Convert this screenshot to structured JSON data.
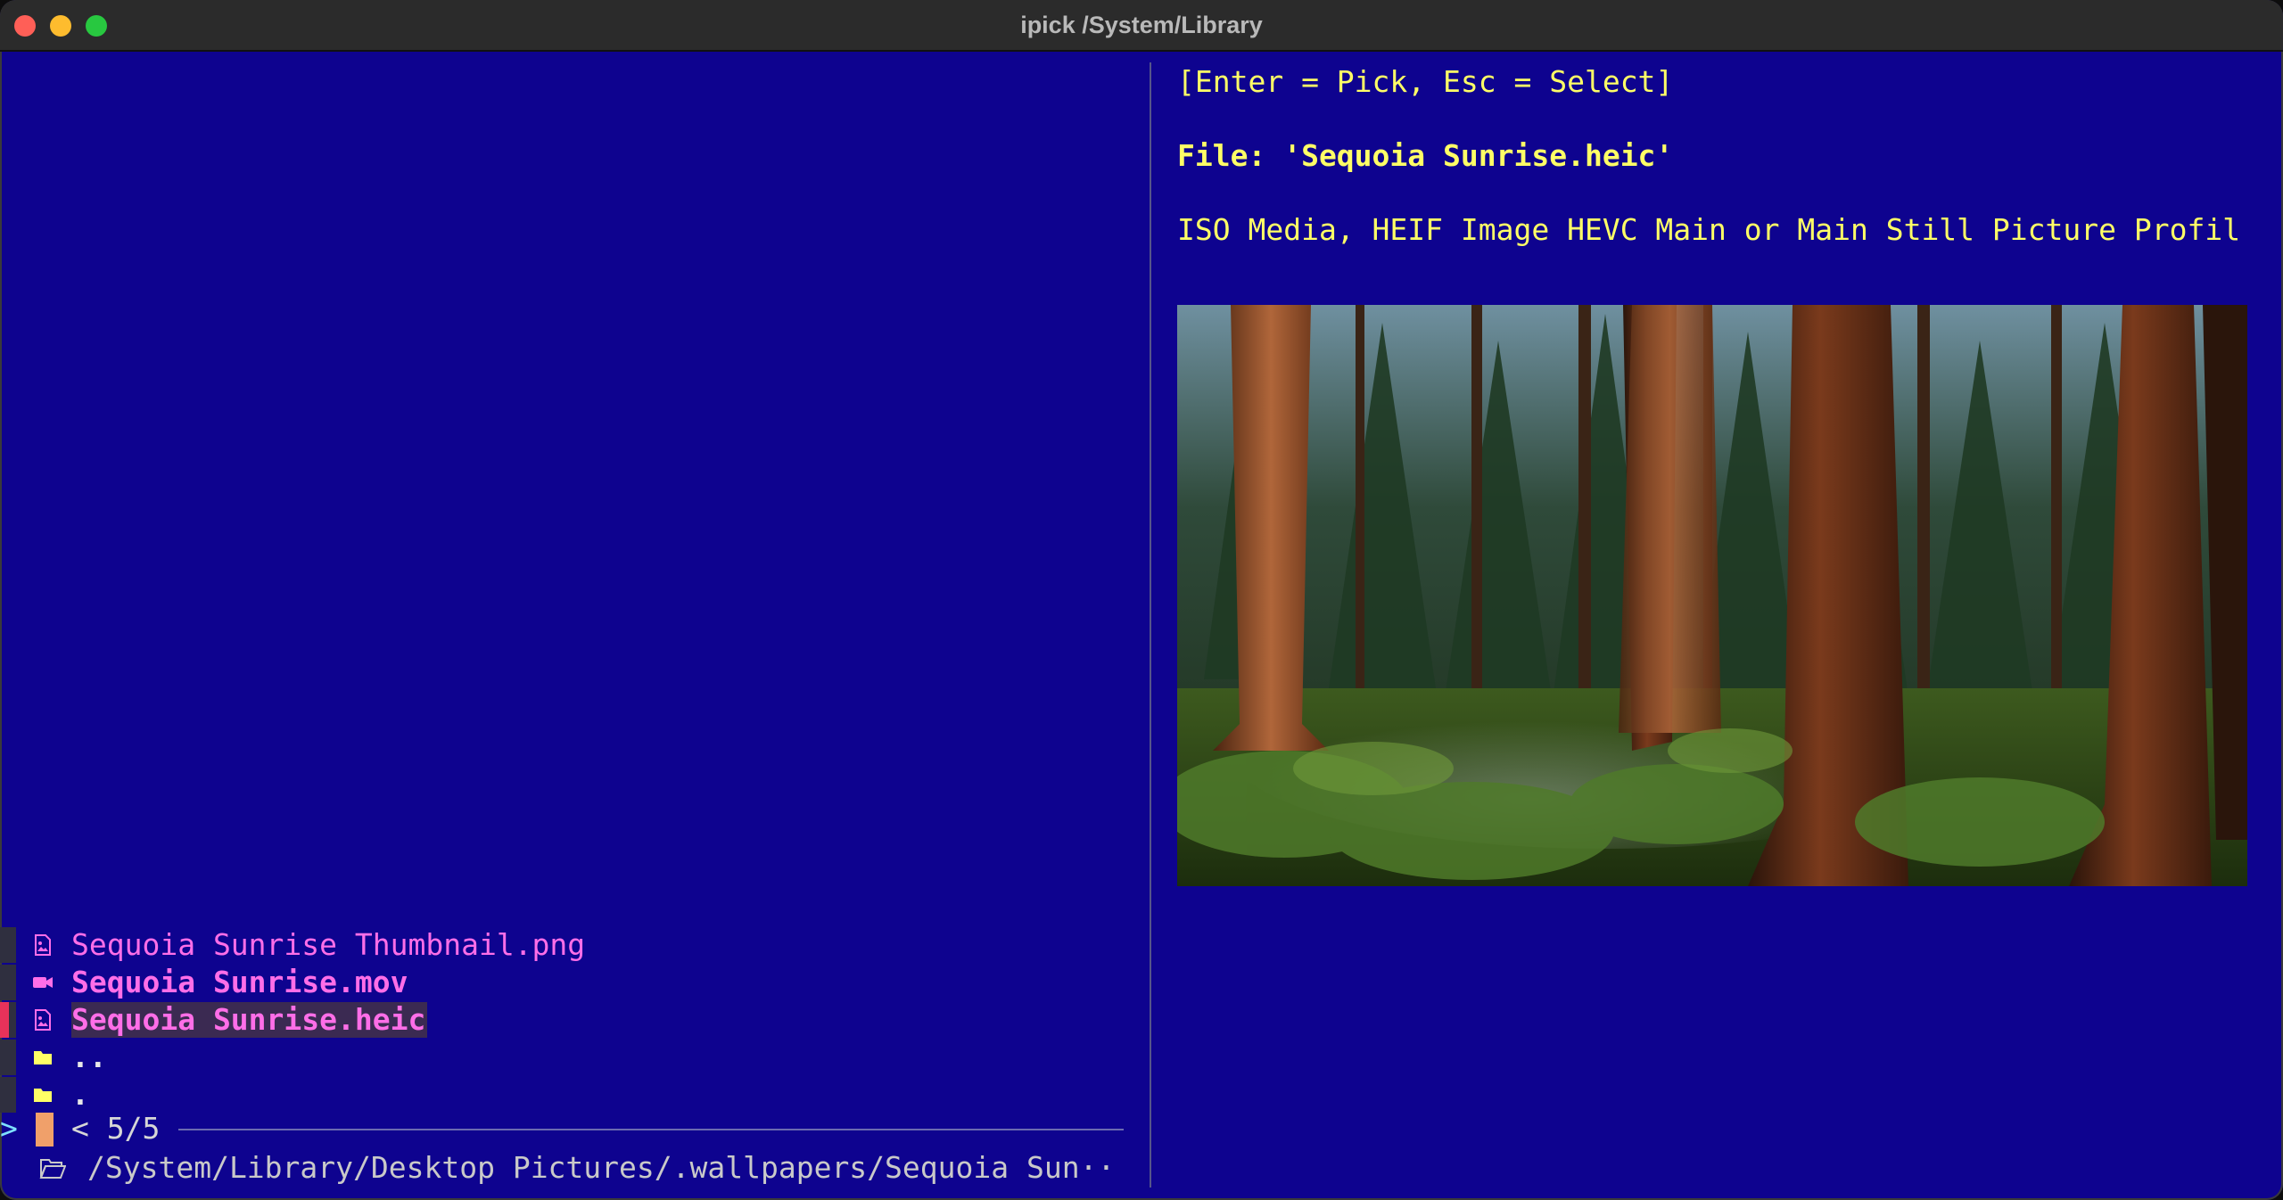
{
  "window": {
    "title": "ipick /System/Library"
  },
  "list": {
    "items": [
      {
        "name": "Sequoia Sunrise Thumbnail.png",
        "icon": "image-file-icon"
      },
      {
        "name": "Sequoia Sunrise.mov",
        "icon": "video-file-icon"
      },
      {
        "name": "Sequoia Sunrise.heic",
        "icon": "image-file-icon",
        "selected": true
      },
      {
        "name": "..",
        "icon": "folder-icon"
      },
      {
        "name": ".",
        "icon": "folder-icon"
      }
    ]
  },
  "prompt": {
    "caret": ">",
    "counter": "< 5/5"
  },
  "path": {
    "text": "/System/Library/Desktop Pictures/.wallpapers/Sequoia Sun··"
  },
  "preview": {
    "help": "[Enter = Pick, Esc = Select]",
    "file_label": "File: 'Sequoia Sunrise.heic'",
    "file_info": "ISO Media, HEIF Image HEVC Main or Main Still Picture Profil",
    "image_alt": "sequoia forest photo"
  },
  "colors": {
    "background": "#0e038f",
    "accent_pink": "#ff6ee8",
    "accent_yellow": "#ffff66"
  }
}
